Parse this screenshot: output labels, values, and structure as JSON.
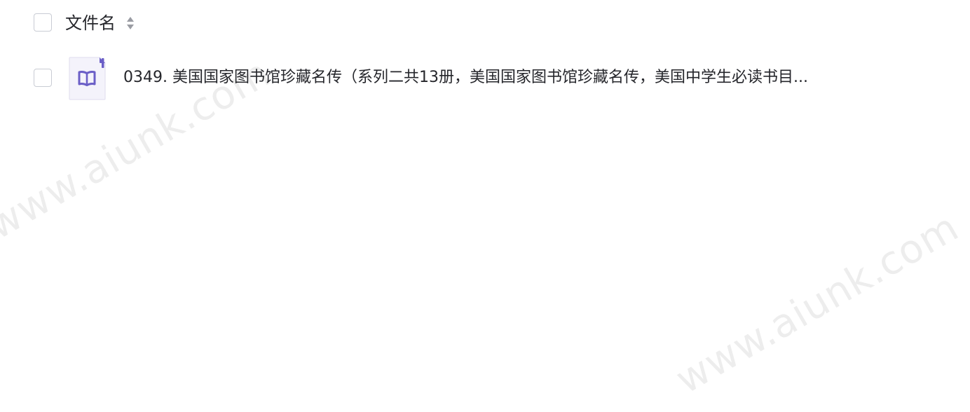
{
  "table": {
    "header": {
      "filename_label": "文件名"
    },
    "rows": [
      {
        "icon": "book-icon",
        "name": "0349. 美国国家图书馆珍藏名传（系列二共13册，美国国家图书馆珍藏名传，美国中学生必读书目..."
      }
    ]
  },
  "watermark": {
    "text": "www.aiunk.com"
  },
  "colors": {
    "icon_accent": "#6b5fc7",
    "icon_bg": "#f4f3fb",
    "checkbox_border": "#c9ccd4",
    "text": "#25262b"
  }
}
